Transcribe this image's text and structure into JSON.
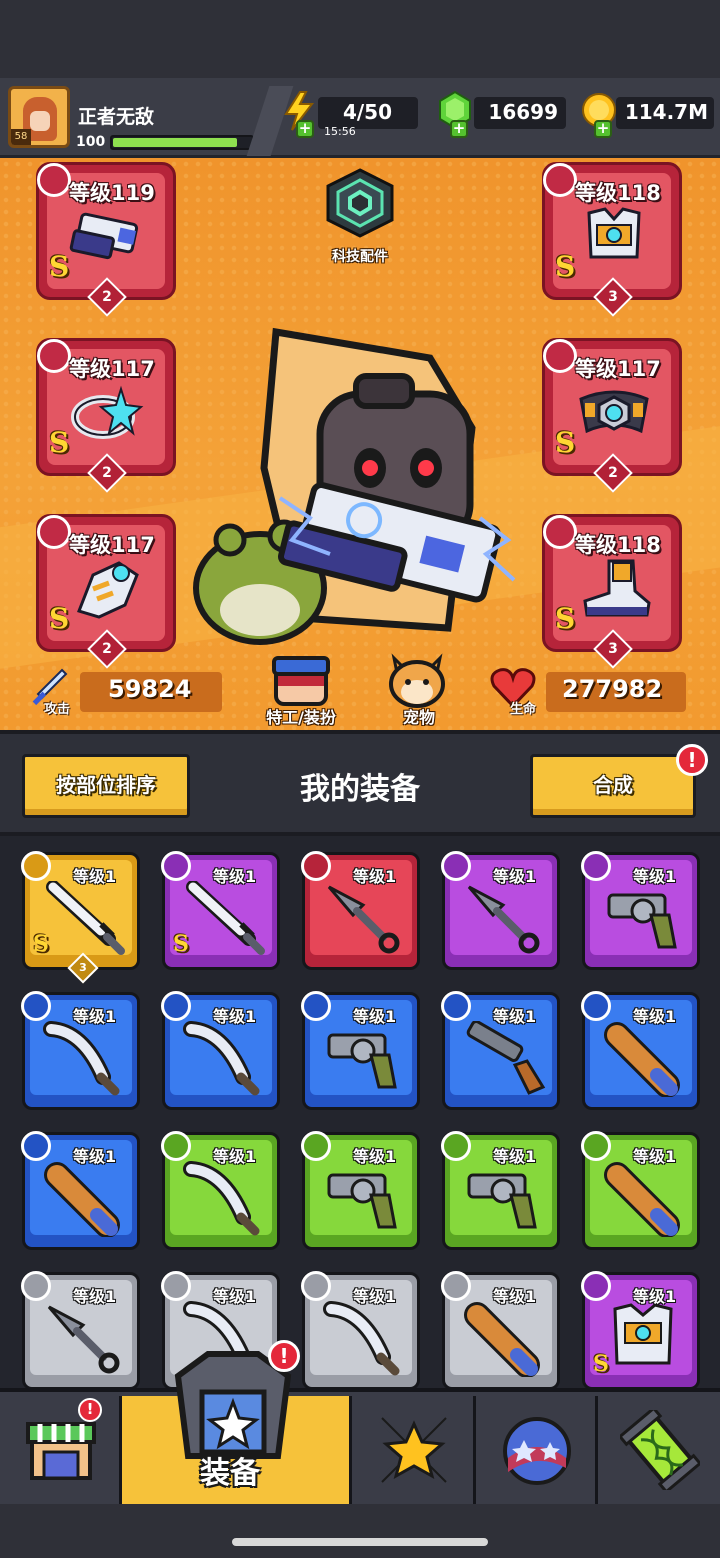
{
  "player": {
    "name": "正者无敌",
    "level": "58",
    "xp_value": "100",
    "xp_fraction": 0.9
  },
  "resources": {
    "energy": {
      "value": "4/50",
      "timer": "15:56",
      "icon": "lightning-icon"
    },
    "gems": {
      "value": "16699",
      "icon": "green-gem-icon"
    },
    "gold": {
      "value": "114.7M",
      "icon": "gold-coin-icon"
    }
  },
  "tech_parts": {
    "label": "科技配件",
    "icon": "hex-chip-icon"
  },
  "equipped_slots": [
    {
      "slot": "weapon",
      "level": "等级119",
      "rank": "S",
      "stars": "2",
      "icon": "blaster-gun-icon"
    },
    {
      "slot": "armor",
      "level": "等级118",
      "rank": "S",
      "stars": "3",
      "icon": "armor-vest-icon"
    },
    {
      "slot": "ring",
      "level": "等级117",
      "rank": "S",
      "stars": "2",
      "icon": "star-ring-icon"
    },
    {
      "slot": "belt",
      "level": "等级117",
      "rank": "S",
      "stars": "2",
      "icon": "belt-icon"
    },
    {
      "slot": "gloves",
      "level": "等级117",
      "rank": "S",
      "stars": "2",
      "icon": "gauntlet-icon"
    },
    {
      "slot": "boots",
      "level": "等级118",
      "rank": "S",
      "stars": "3",
      "icon": "boot-icon"
    }
  ],
  "stats": {
    "attack_label": "攻击",
    "attack_value": "59824",
    "hp_label": "生命",
    "hp_value": "277982",
    "agent_label": "特工/装扮",
    "pet_label": "宠物"
  },
  "equipment_header": {
    "sort_button": "按部位排序",
    "title": "我的装备",
    "merge_button": "合成",
    "merge_badge": "!"
  },
  "inventory": [
    {
      "level": "等级1",
      "color": "gold",
      "item": "katana",
      "rank": "S",
      "stars": "3"
    },
    {
      "level": "等级1",
      "color": "purple",
      "item": "katana",
      "rank": "S",
      "stars": ""
    },
    {
      "level": "等级1",
      "color": "red",
      "item": "kunai",
      "rank": "",
      "stars": ""
    },
    {
      "level": "等级1",
      "color": "purple",
      "item": "kunai",
      "rank": "",
      "stars": ""
    },
    {
      "level": "等级1",
      "color": "purple",
      "item": "revolver",
      "rank": "",
      "stars": ""
    },
    {
      "level": "等级1",
      "color": "blue",
      "item": "machete",
      "rank": "",
      "stars": ""
    },
    {
      "level": "等级1",
      "color": "blue",
      "item": "machete",
      "rank": "",
      "stars": ""
    },
    {
      "level": "等级1",
      "color": "blue",
      "item": "revolver",
      "rank": "",
      "stars": ""
    },
    {
      "level": "等级1",
      "color": "blue",
      "item": "shotgun",
      "rank": "",
      "stars": ""
    },
    {
      "level": "等级1",
      "color": "blue",
      "item": "bat",
      "rank": "",
      "stars": ""
    },
    {
      "level": "等级1",
      "color": "blue",
      "item": "bat",
      "rank": "",
      "stars": ""
    },
    {
      "level": "等级1",
      "color": "green",
      "item": "machete",
      "rank": "",
      "stars": ""
    },
    {
      "level": "等级1",
      "color": "green",
      "item": "revolver",
      "rank": "",
      "stars": ""
    },
    {
      "level": "等级1",
      "color": "green",
      "item": "revolver",
      "rank": "",
      "stars": ""
    },
    {
      "level": "等级1",
      "color": "green",
      "item": "bat",
      "rank": "",
      "stars": ""
    },
    {
      "level": "等级1",
      "color": "grey",
      "item": "kunai",
      "rank": "",
      "stars": ""
    },
    {
      "level": "等级1",
      "color": "grey",
      "item": "machete",
      "rank": "",
      "stars": ""
    },
    {
      "level": "等级1",
      "color": "grey",
      "item": "machete",
      "rank": "",
      "stars": ""
    },
    {
      "level": "等级1",
      "color": "grey",
      "item": "bat",
      "rank": "",
      "stars": ""
    },
    {
      "level": "等级1",
      "color": "purple",
      "item": "armor",
      "rank": "S",
      "stars": ""
    }
  ],
  "colors": {
    "gold": [
      "#f6c23a",
      "#d99a16"
    ],
    "purple": [
      "#b94de0",
      "#8a2fb5"
    ],
    "red": [
      "#e64658",
      "#b6243a"
    ],
    "blue": [
      "#3a7cf0",
      "#2353c4"
    ],
    "green": [
      "#86d83c",
      "#5aa622"
    ],
    "grey": [
      "#c9ccd3",
      "#9a9da6"
    ]
  },
  "bottom_nav": {
    "active_label": "装备",
    "tabs": [
      {
        "name": "shop",
        "icon": "shop-stall-icon",
        "badge": "!"
      },
      {
        "name": "equipment",
        "icon": "equipment-bag-icon",
        "badge": "!"
      },
      {
        "name": "battle",
        "icon": "crossed-swords-star-icon"
      },
      {
        "name": "world",
        "icon": "star-planet-icon"
      },
      {
        "name": "gene",
        "icon": "dna-capsule-icon"
      }
    ]
  }
}
